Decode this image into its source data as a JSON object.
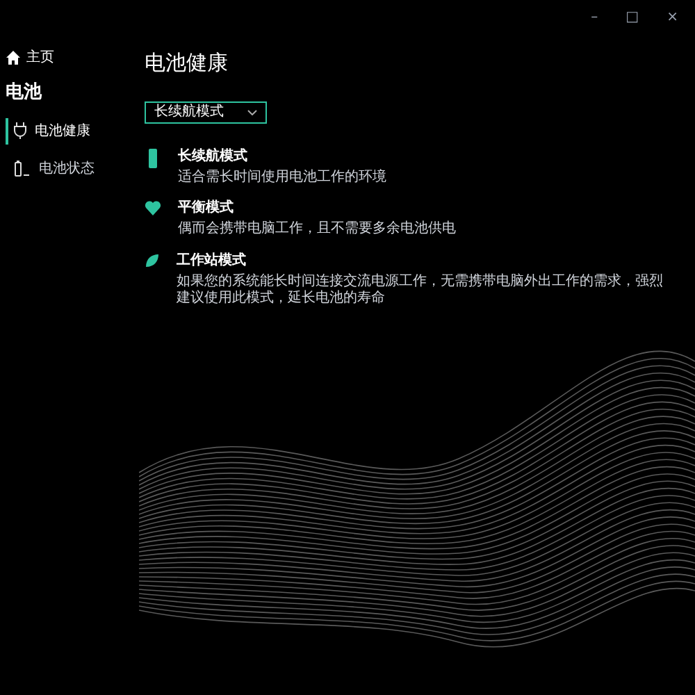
{
  "window": {
    "controls": [
      "–",
      "□",
      "×"
    ]
  },
  "sidebar": {
    "home": "主页",
    "section": "电池",
    "items": [
      {
        "label": "电池健康",
        "kind": "plug",
        "selected": true
      },
      {
        "label": "电池状态",
        "kind": "battery",
        "selected": false
      }
    ]
  },
  "page": {
    "title": "电池健康",
    "dropdown": {
      "value": "长续航模式"
    },
    "modes": [
      {
        "kind": "battery",
        "name": "长续航模式",
        "description": "适合需长时间使用电池工作的环境"
      },
      {
        "kind": "heart",
        "name": "平衡模式",
        "description": "偶而会携带电脑工作，且不需要多余电池供电"
      },
      {
        "kind": "leaf",
        "name": "工作站模式",
        "description": "如果您的系统能长时间连接交流电源工作，无需携带电脑外出工作的需求，强烈建议使用此模式，延长电池的寿命"
      }
    ]
  }
}
